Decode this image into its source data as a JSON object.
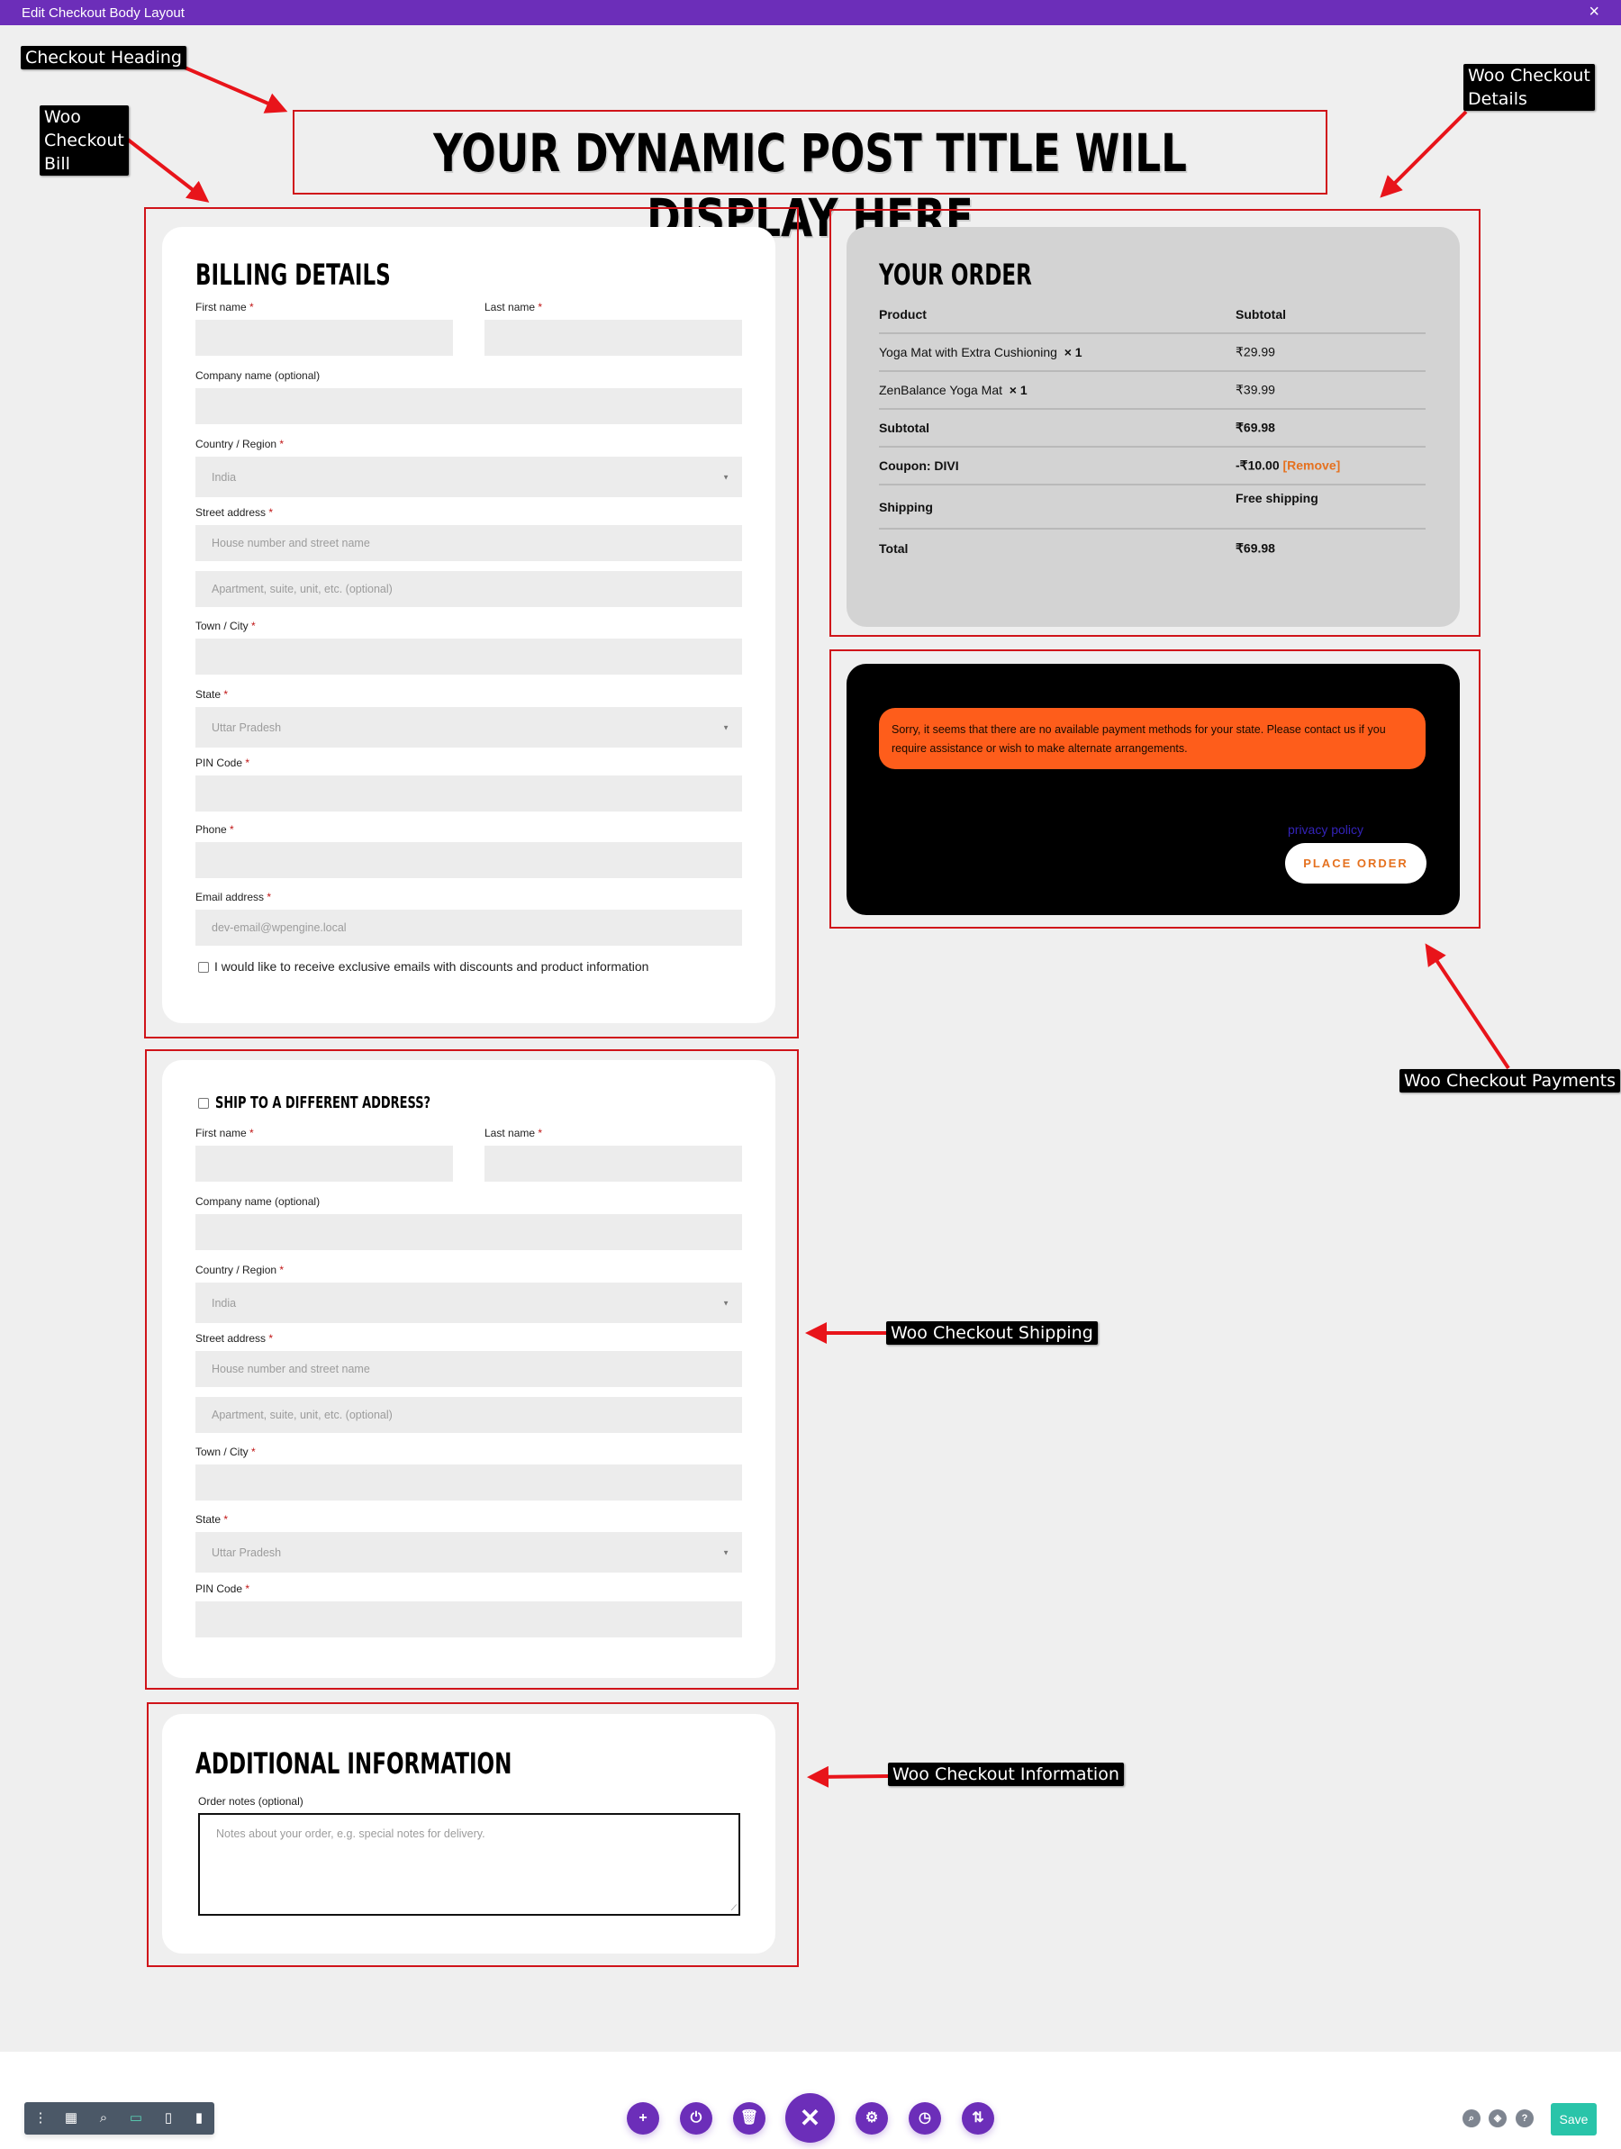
{
  "window": {
    "title": "Edit Checkout Body Layout",
    "close_icon": "×"
  },
  "callouts": {
    "heading": "Checkout Heading",
    "bill": [
      "Woo",
      "Checkout",
      "Bill"
    ],
    "details": [
      "Woo Checkout",
      "Details"
    ],
    "payments": "Woo Checkout Payments",
    "shipping": "Woo Checkout Shipping",
    "information": "Woo Checkout Information"
  },
  "heading": {
    "text": "YOUR DYNAMIC POST TITLE WILL DISPLAY HERE"
  },
  "billing": {
    "title": "BILLING DETAILS",
    "required_mark": "*",
    "fields": {
      "first_name": {
        "label": "First name",
        "value": ""
      },
      "last_name": {
        "label": "Last name",
        "value": ""
      },
      "company": {
        "label": "Company name (optional)",
        "value": ""
      },
      "country": {
        "label": "Country / Region",
        "value": "India"
      },
      "street": {
        "label": "Street address",
        "placeholder1": "House number and street name",
        "placeholder2": "Apartment, suite, unit, etc. (optional)"
      },
      "city": {
        "label": "Town / City",
        "value": ""
      },
      "state": {
        "label": "State",
        "value": "Uttar Pradesh"
      },
      "pin": {
        "label": "PIN Code",
        "value": ""
      },
      "phone": {
        "label": "Phone",
        "value": ""
      },
      "email": {
        "label": "Email address",
        "placeholder": "dev-email@wpengine.local"
      }
    },
    "newsletter": {
      "label": "I would like to receive exclusive emails with discounts and product information",
      "checked": false
    }
  },
  "shipping": {
    "toggle_label": "SHIP TO A DIFFERENT ADDRESS?",
    "toggle_checked": false,
    "fields": {
      "first_name": {
        "label": "First name"
      },
      "last_name": {
        "label": "Last name"
      },
      "company": {
        "label": "Company name (optional)"
      },
      "country": {
        "label": "Country / Region",
        "value": "India"
      },
      "street": {
        "label": "Street address",
        "placeholder1": "House number and street name",
        "placeholder2": "Apartment, suite, unit, etc. (optional)"
      },
      "city": {
        "label": "Town / City"
      },
      "state": {
        "label": "State",
        "value": "Uttar Pradesh"
      },
      "pin": {
        "label": "PIN Code"
      }
    }
  },
  "order": {
    "title": "YOUR ORDER",
    "headers": {
      "product": "Product",
      "subtotal": "Subtotal"
    },
    "items": [
      {
        "name": "Yoga Mat with Extra Cushioning",
        "qty": "× 1",
        "price": "₹29.99"
      },
      {
        "name": "ZenBalance Yoga Mat",
        "qty": "× 1",
        "price": "₹39.99"
      }
    ],
    "subtotal": {
      "label": "Subtotal",
      "value": "₹69.98"
    },
    "coupon": {
      "label": "Coupon: DIVI",
      "value": "-₹10.00",
      "remove": "[Remove]"
    },
    "shipping": {
      "label": "Shipping",
      "value": "Free shipping"
    },
    "total": {
      "label": "Total",
      "value": "₹69.98"
    }
  },
  "payment": {
    "notice": "Sorry, it seems that there are no available payment methods for your state. Please contact us if you require assistance or wish to make alternate arrangements.",
    "privacy_link": "privacy policy",
    "place_order": "PLACE ORDER"
  },
  "additional": {
    "title": "ADDITIONAL INFORMATION",
    "notes_label": "Order notes (optional)",
    "notes_placeholder": "Notes about your order, e.g. special notes for delivery."
  },
  "toolbar": {
    "view_icons": [
      "more-icon",
      "wireframe-icon",
      "zoom-icon",
      "desktop-icon",
      "tablet-icon",
      "phone-icon"
    ],
    "actions": [
      "add",
      "portability",
      "clear",
      "close",
      "settings",
      "history",
      "page-transfer"
    ],
    "right_icons": [
      "search",
      "layers",
      "help"
    ],
    "save_label": "Save"
  },
  "colors": {
    "brand_purple": "#6c2eb9",
    "annotation_red": "#d0141a",
    "notice_orange": "#fe5d1b",
    "accent_orange": "#e5711f",
    "save_green": "#29c4a9"
  }
}
